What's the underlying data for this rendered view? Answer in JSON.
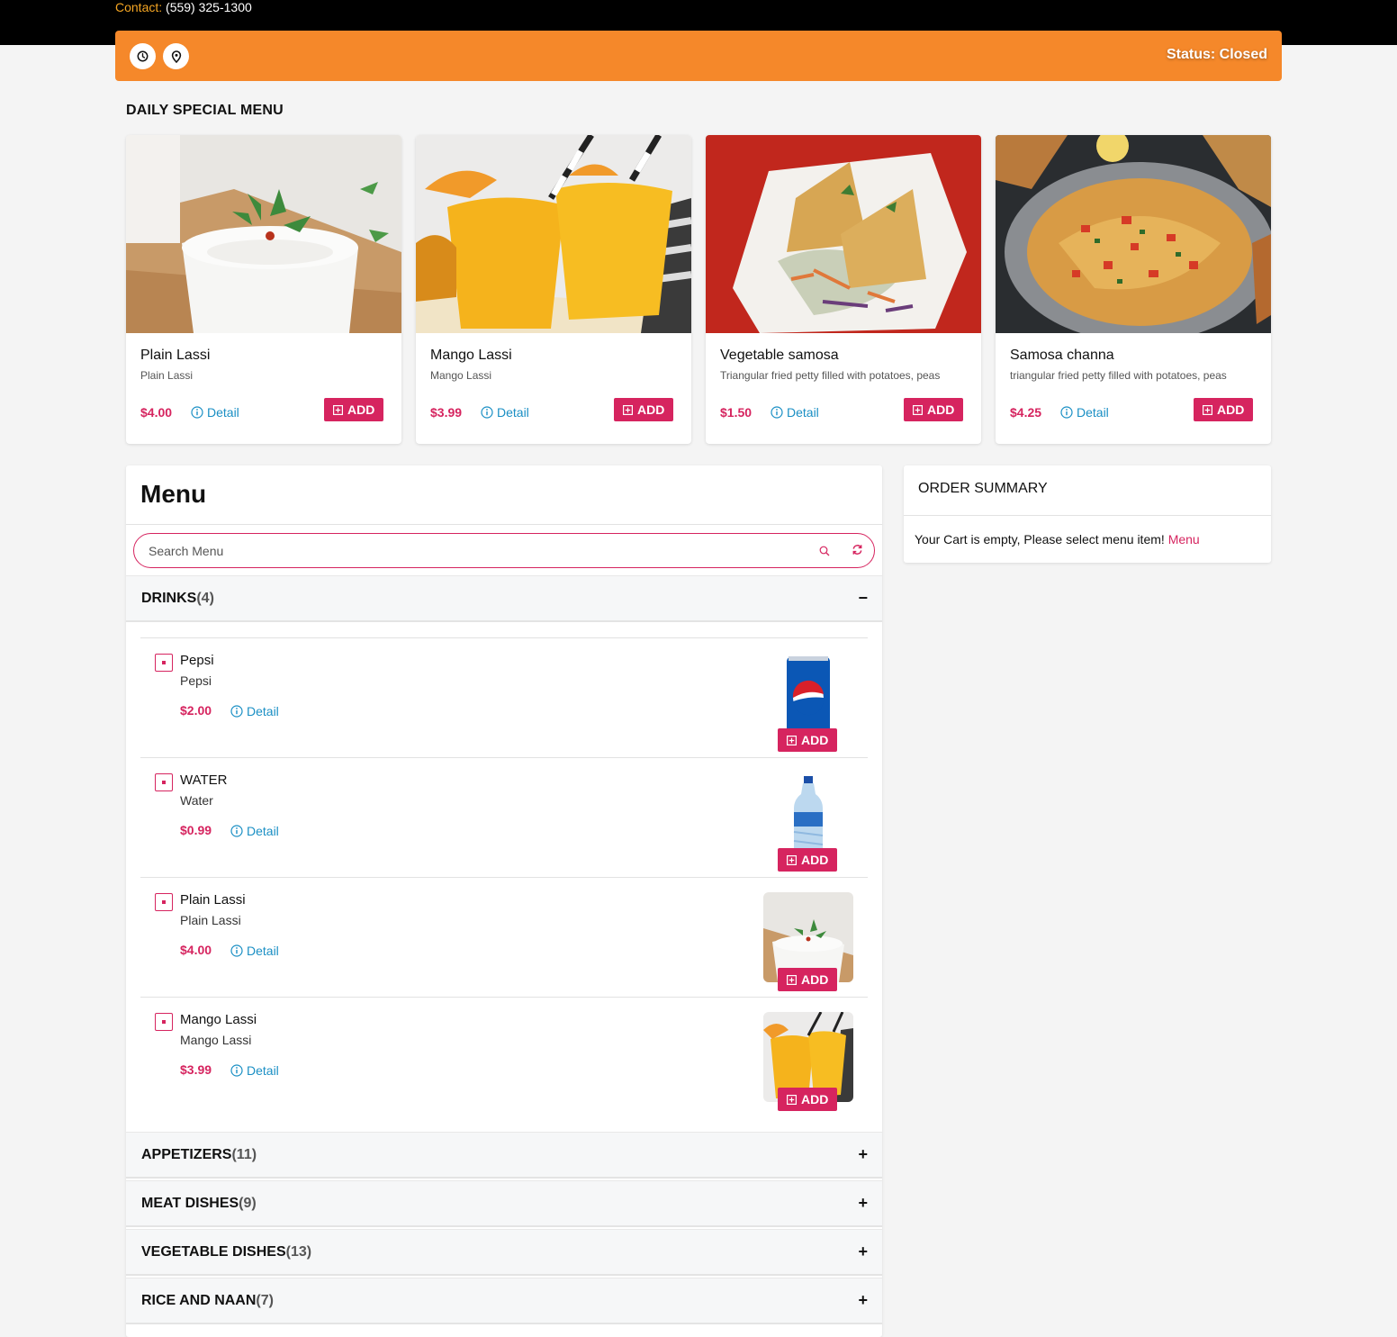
{
  "header": {
    "contact_label": "Contact:",
    "contact_phone": "(559) 325-1300",
    "status": "Status: Closed"
  },
  "specials": {
    "title": "DAILY SPECIAL MENU",
    "items": [
      {
        "name": "Plain Lassi",
        "desc": "Plain Lassi",
        "price": "$4.00",
        "detail": "Detail",
        "add": "ADD"
      },
      {
        "name": "Mango Lassi",
        "desc": "Mango Lassi",
        "price": "$3.99",
        "detail": "Detail",
        "add": "ADD"
      },
      {
        "name": "Vegetable samosa",
        "desc": "Triangular fried petty filled with potatoes, peas",
        "price": "$1.50",
        "detail": "Detail",
        "add": "ADD"
      },
      {
        "name": "Samosa channa",
        "desc": "triangular fried petty filled with potatoes, peas",
        "price": "$4.25",
        "detail": "Detail",
        "add": "ADD"
      }
    ]
  },
  "menu": {
    "title": "Menu",
    "search_placeholder": "Search Menu",
    "categories": [
      {
        "name": "DRINKS",
        "count": "(4)",
        "toggle": "−"
      },
      {
        "name": "APPETIZERS",
        "count": "(11)",
        "toggle": "+"
      },
      {
        "name": "MEAT DISHES",
        "count": "(9)",
        "toggle": "+"
      },
      {
        "name": "VEGETABLE DISHES",
        "count": "(13)",
        "toggle": "+"
      },
      {
        "name": "RICE AND NAAN",
        "count": "(7)",
        "toggle": "+"
      }
    ],
    "drinks": [
      {
        "name": "Pepsi",
        "desc": "Pepsi",
        "price": "$2.00",
        "detail": "Detail",
        "add": "ADD"
      },
      {
        "name": "WATER",
        "desc": "Water",
        "price": "$0.99",
        "detail": "Detail",
        "add": "ADD"
      },
      {
        "name": "Plain Lassi",
        "desc": "Plain Lassi",
        "price": "$4.00",
        "detail": "Detail",
        "add": "ADD"
      },
      {
        "name": "Mango Lassi",
        "desc": "Mango Lassi",
        "price": "$3.99",
        "detail": "Detail",
        "add": "ADD"
      }
    ]
  },
  "summary": {
    "title": "ORDER SUMMARY",
    "empty_text": "Your Cart is empty, Please select menu item!",
    "menu_link": "Menu"
  },
  "icons": [
    "clock-icon",
    "location-pin-icon",
    "info-icon",
    "plus-square-icon",
    "search-icon",
    "refresh-icon"
  ],
  "colors": {
    "accent": "#d6245f",
    "orange": "#f5882a",
    "link": "#1a8fc4"
  }
}
